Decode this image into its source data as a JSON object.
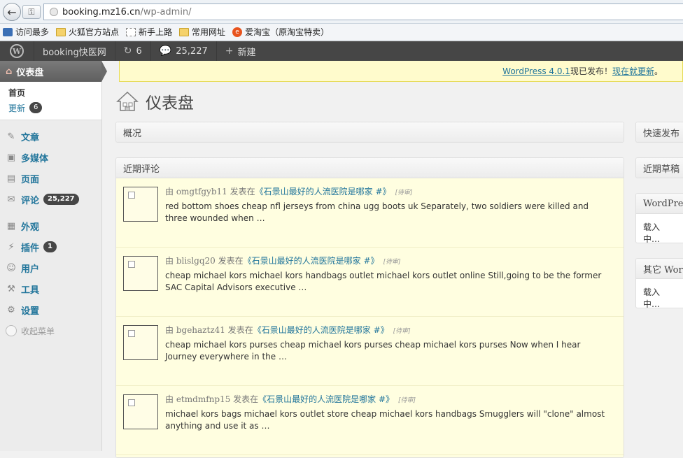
{
  "browser": {
    "url_host": "booking.mz16.cn",
    "url_path": "/wp-admin/",
    "bookmarks": [
      {
        "label": "访问最多",
        "icon": "search-icon"
      },
      {
        "label": "火狐官方站点",
        "icon": "folder-icon"
      },
      {
        "label": "新手上路",
        "icon": "page-icon"
      },
      {
        "label": "常用网址",
        "icon": "folder-icon"
      },
      {
        "label": "爱淘宝（原淘宝特卖）",
        "icon": "taobao-icon"
      }
    ]
  },
  "adminbar": {
    "logo": "W",
    "site_name": "booking快医网",
    "updates_count": "6",
    "comments_count": "25,227",
    "new_label": "新建"
  },
  "sidebar": {
    "current": "仪表盘",
    "sub_home": "首页",
    "sub_updates": "更新",
    "sub_updates_count": "6",
    "items": [
      {
        "label": "文章",
        "icon": "pin-icon",
        "glyph": "✎"
      },
      {
        "label": "多媒体",
        "icon": "media-icon",
        "glyph": "▣"
      },
      {
        "label": "页面",
        "icon": "page-icon",
        "glyph": "▤"
      },
      {
        "label": "评论",
        "icon": "comment-icon",
        "glyph": "✉",
        "count": "25,227"
      },
      {
        "label": "外观",
        "icon": "appearance-icon",
        "glyph": "▦"
      },
      {
        "label": "插件",
        "icon": "plugin-icon",
        "glyph": "⚡",
        "count": "1"
      },
      {
        "label": "用户",
        "icon": "users-icon",
        "glyph": "☺"
      },
      {
        "label": "工具",
        "icon": "tools-icon",
        "glyph": "⚒"
      },
      {
        "label": "设置",
        "icon": "settings-icon",
        "glyph": "⚙"
      }
    ],
    "collapse": "收起菜单"
  },
  "notice": {
    "link1": "WordPress 4.0.1",
    "middle": " 现已发布！",
    "link2": "现在就更新",
    "end": "。"
  },
  "page": {
    "title": "仪表盘"
  },
  "widgets": {
    "overview": "概况",
    "recent_comments": "近期评论",
    "quick_press": "快速发布",
    "recent_drafts": "近期草稿",
    "wp_blog": "WordPress",
    "wp_blog_loading": "载入中…",
    "other_news": "其它 WordPress 新闻",
    "other_news_loading": "载入中…"
  },
  "comments": [
    {
      "prefix": "由 ",
      "author": "omgtfgyb11",
      "posted": " 发表在",
      "post": "《石景山最好的人流医院是哪家 #》",
      "status": "[待审]",
      "text": "red bottom shoes cheap nfl jerseys from china ugg boots uk Separately, two soldiers were killed and three wounded when …"
    },
    {
      "prefix": "由 ",
      "author": "blislgq20",
      "posted": " 发表在",
      "post": "《石景山最好的人流医院是哪家 #》",
      "status": "[待审]",
      "text": "cheap michael kors michael kors handbags outlet michael kors outlet online Still,going to be the former SAC Capital Advisors executive …"
    },
    {
      "prefix": "由 ",
      "author": "bgehaztz41",
      "posted": " 发表在",
      "post": "《石景山最好的人流医院是哪家 #》",
      "status": "[待审]",
      "text": "cheap michael kors purses cheap michael kors purses cheap michael kors purses Now when I hear Journey everywhere in the …"
    },
    {
      "prefix": "由 ",
      "author": "etmdmfnp15",
      "posted": " 发表在",
      "post": "《石景山最好的人流医院是哪家 #》",
      "status": "[待审]",
      "text": "michael kors bags michael kors outlet store cheap michael kors handbags Smugglers will \"clone\" almost anything and use it as …"
    }
  ]
}
